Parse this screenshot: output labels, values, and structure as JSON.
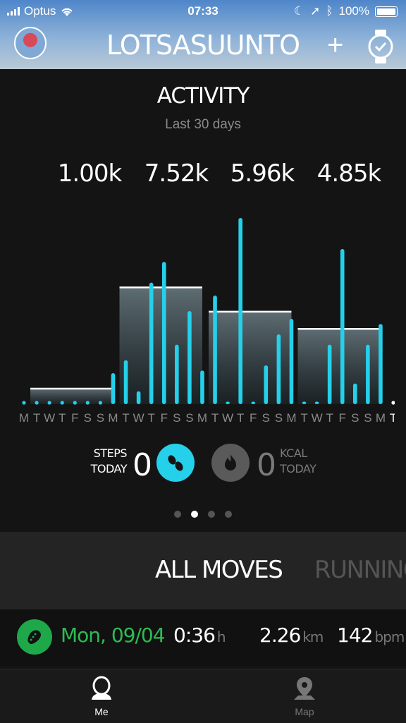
{
  "status_bar": {
    "carrier": "Optus",
    "time": "07:33",
    "battery": "100%"
  },
  "header": {
    "title": "LOTSASUUNTO",
    "add_icon": "plus-icon",
    "watch_icon": "watch-check-icon"
  },
  "activity": {
    "title": "ACTIVITY",
    "subtitle": "Last 30 days",
    "week_totals": [
      "1.00k",
      "7.52k",
      "5.96k",
      "4.85k"
    ]
  },
  "chart_data": {
    "type": "bar",
    "categories": [
      "M",
      "T",
      "W",
      "T",
      "F",
      "S",
      "S",
      "M",
      "T",
      "W",
      "T",
      "F",
      "S",
      "S",
      "M",
      "T",
      "W",
      "T",
      "F",
      "S",
      "S",
      "M",
      "T",
      "W",
      "T",
      "F",
      "S",
      "S",
      "M",
      "T"
    ],
    "values": [
      0,
      0,
      0,
      0,
      0,
      0,
      0,
      1.2,
      1.7,
      0.5,
      4.7,
      5.5,
      2.3,
      3.6,
      1.3,
      4.2,
      0.1,
      7.2,
      0.1,
      1.5,
      2.7,
      3.3,
      0.1,
      0.1,
      2.3,
      6.0,
      0.8,
      2.3,
      3.1,
      0
    ],
    "week_averages": [
      1.0,
      7.52,
      5.96,
      4.85
    ],
    "week_average_scale": 0.6,
    "ylim": [
      0,
      7.5
    ],
    "bar_color": "#25d0ea",
    "grid": false
  },
  "today": {
    "steps_label_1": "STEPS",
    "steps_label_2": "TODAY",
    "steps_value": "0",
    "kcal_value": "0",
    "kcal_label_1": "KCAL",
    "kcal_label_2": "TODAY",
    "steps_icon": "footsteps-icon",
    "kcal_icon": "flame-icon",
    "steps_color": "#25d0ea",
    "kcal_color": "#7a7a7a"
  },
  "pager": {
    "count": 4,
    "active": 1
  },
  "tabs": {
    "all": "ALL MOVES",
    "running": "RUNNING"
  },
  "moves": [
    {
      "date": "Mon, 09/04",
      "duration": "0:36",
      "duration_unit": "h",
      "distance": "2.26",
      "distance_unit": "km",
      "hr": "142",
      "hr_unit": "bpm",
      "color": "#2dbb54"
    }
  ],
  "nav": {
    "me": "Me",
    "map": "Map"
  }
}
